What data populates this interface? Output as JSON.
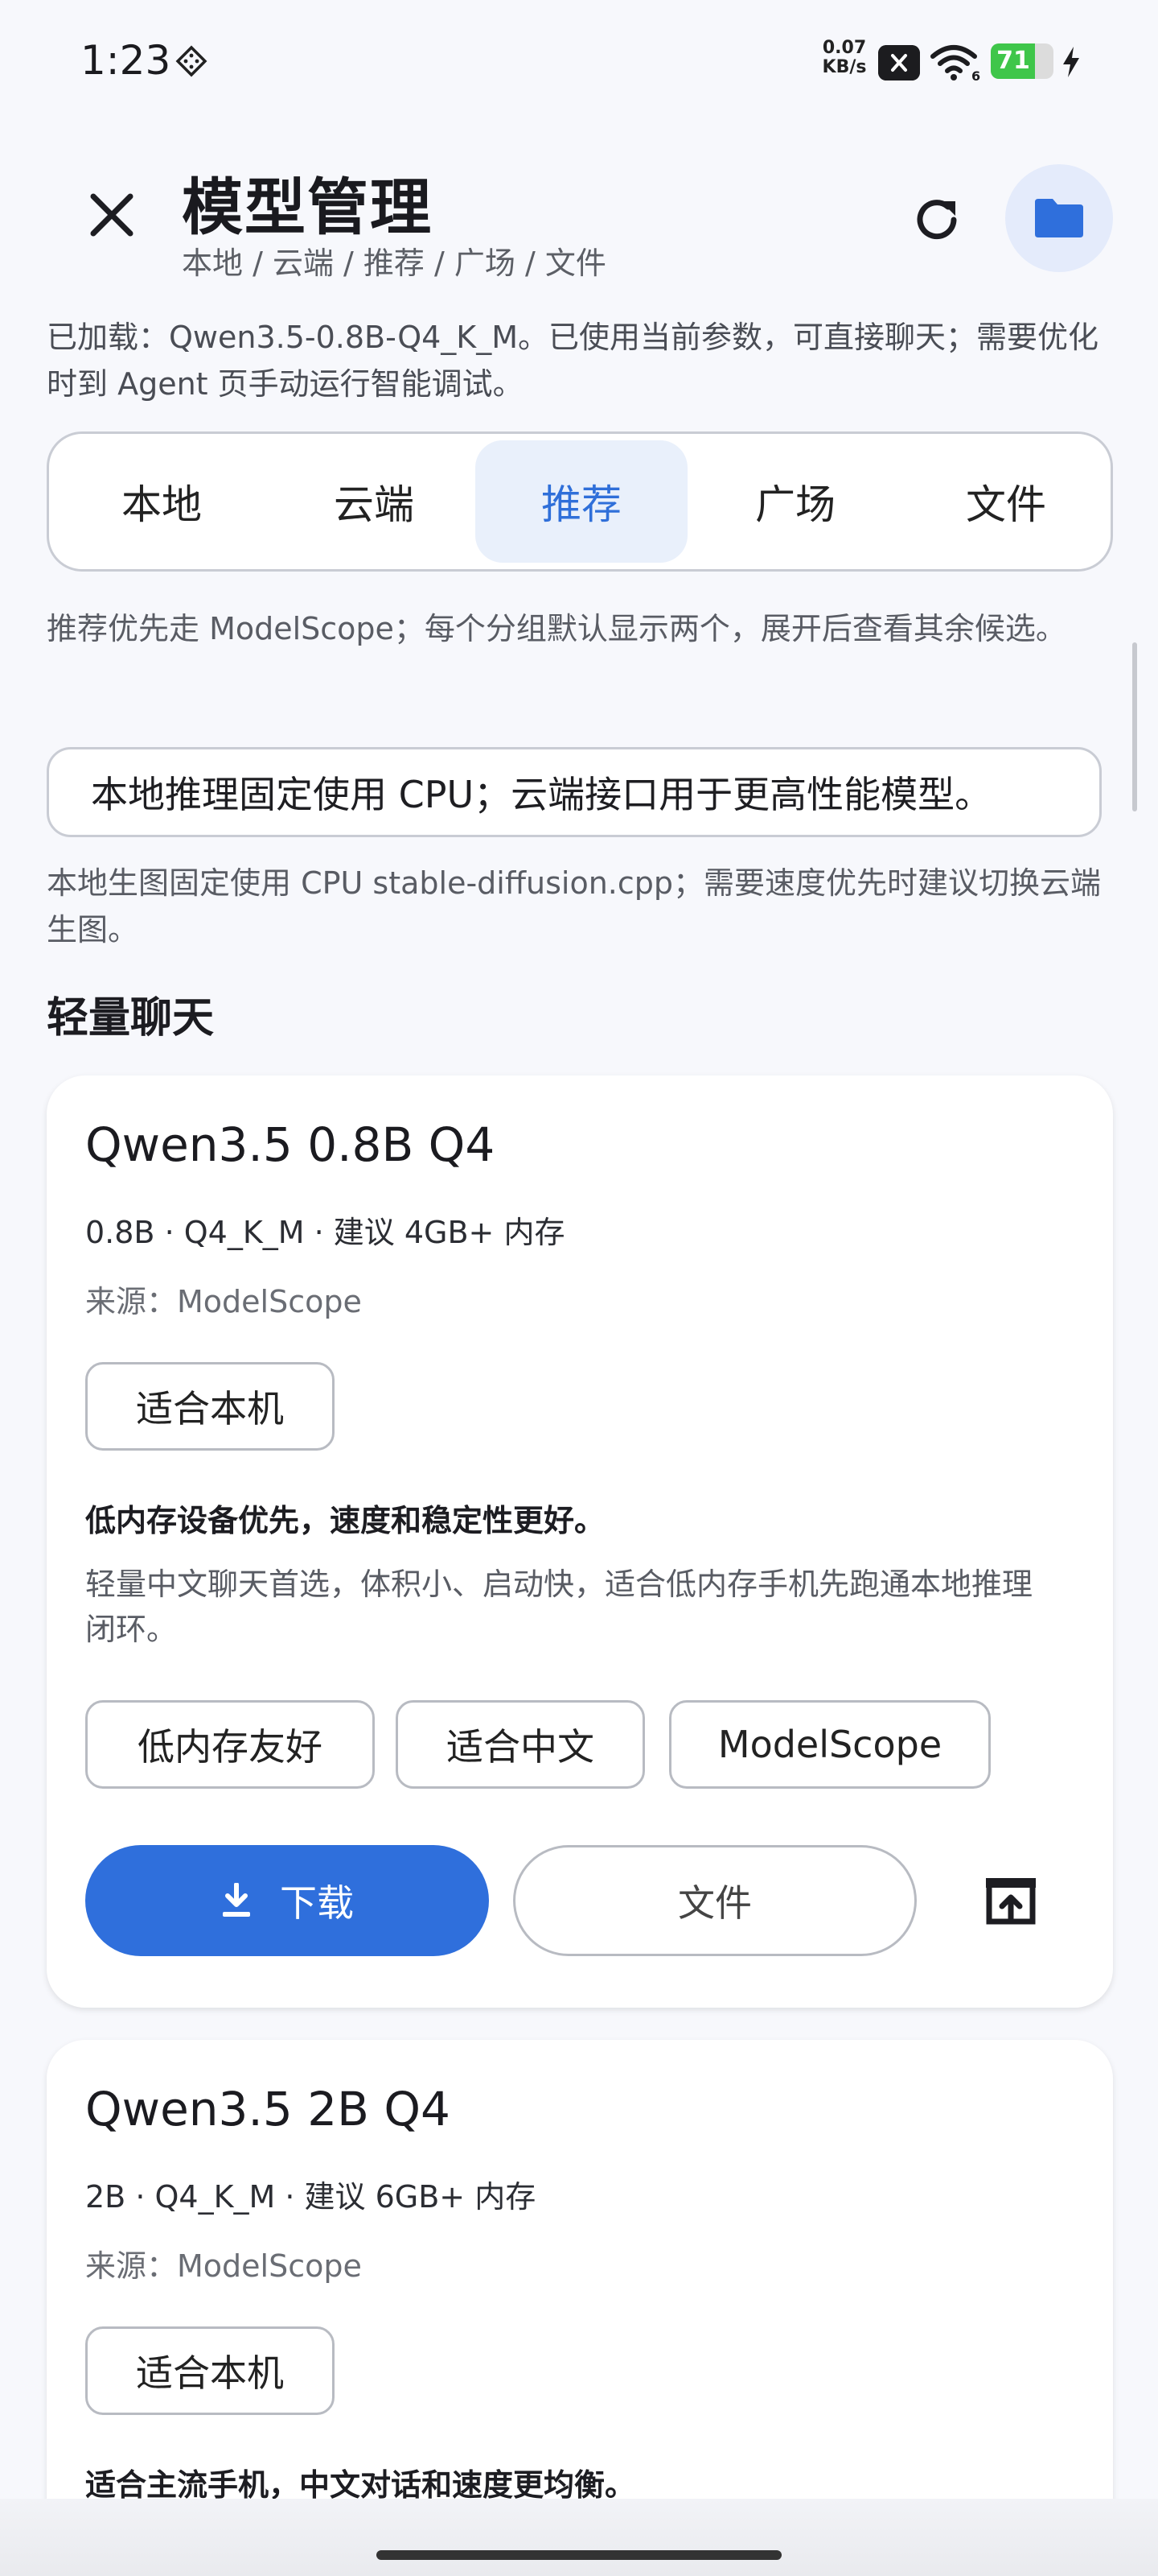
{
  "status_bar": {
    "time": "1:23",
    "net_speed_value": "0.07",
    "net_speed_unit": "KB/s",
    "battery_percent": "71",
    "battery_level": 0.71,
    "battery_color": "#3fc64a"
  },
  "header": {
    "title": "模型管理",
    "breadcrumb": "本地 / 云端 / 推荐 / 广场 / 文件",
    "close_icon": "close-icon",
    "refresh_icon": "refresh-icon",
    "folder_icon": "folder-icon"
  },
  "loaded_info": "已加载：Qwen3.5-0.8B-Q4_K_M。已使用当前参数，可直接聊天；需要优化时到 Agent 页手动运行智能调试。",
  "tabs": [
    {
      "label": "本地"
    },
    {
      "label": "云端"
    },
    {
      "label": "推荐",
      "active": true
    },
    {
      "label": "广场"
    },
    {
      "label": "文件"
    }
  ],
  "recommend_hint": "推荐优先走 ModelScope；每个分组默认显示两个，展开后查看其余候选。",
  "cpu_banner": "本地推理固定使用 CPU；云端接口用于更高性能模型。",
  "image_gen_hint": "本地生图固定使用 CPU stable-diffusion.cpp；需要速度优先时建议切换云端生图。",
  "section_title": "轻量聊天",
  "models": [
    {
      "name": "Qwen3.5 0.8B Q4",
      "meta": "0.8B · Q4_K_M · 建议 4GB+ 内存",
      "source": "来源：ModelScope",
      "fit_badge": "适合本机",
      "highlight": "低内存设备优先，速度和稳定性更好。",
      "description": "轻量中文聊天首选，体积小、启动快，适合低内存手机先跑通本地推理闭环。",
      "tags": [
        "低内存友好",
        "适合中文",
        "ModelScope"
      ],
      "download_label": "下载",
      "files_label": "文件"
    },
    {
      "name": "Qwen3.5 2B Q4",
      "meta": "2B · Q4_K_M · 建议 6GB+ 内存",
      "source": "来源：ModelScope",
      "fit_badge": "适合本机",
      "highlight": "适合主流手机，中文对话和速度更均衡。"
    }
  ],
  "colors": {
    "accent": "#2f6fdc",
    "tab_active_bg": "#e9f0fb",
    "page_bg": "#f7f8fc"
  }
}
